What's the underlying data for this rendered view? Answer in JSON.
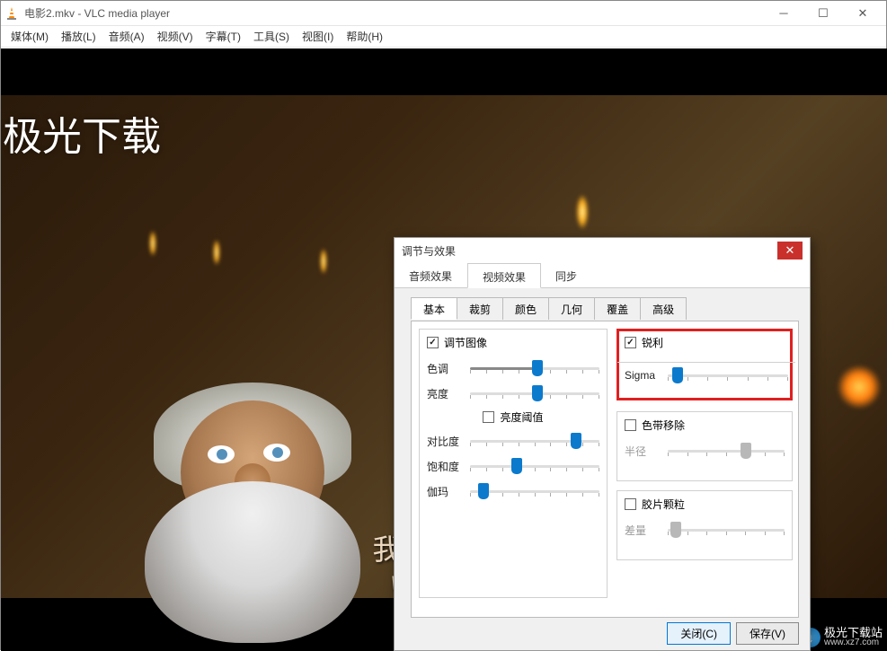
{
  "window": {
    "title": "电影2.mkv - VLC media player"
  },
  "menubar": {
    "items": [
      "媒体(M)",
      "播放(L)",
      "音频(A)",
      "视频(V)",
      "字幕(T)",
      "工具(S)",
      "视图(I)",
      "帮助(H)"
    ]
  },
  "video": {
    "watermark_top": "极光下载",
    "subtitle_cn": "我们回家去",
    "subtitle_en": "We'll go hon",
    "watermark_br_name": "极光下载站",
    "watermark_br_url": "www.xz7.com"
  },
  "dialog": {
    "title": "调节与效果",
    "main_tabs": {
      "audio": "音频效果",
      "video": "视频效果",
      "sync": "同步"
    },
    "sub_tabs": {
      "basic": "基本",
      "crop": "裁剪",
      "color": "颜色",
      "geo": "几何",
      "overlay": "覆盖",
      "adv": "高级"
    },
    "left_group": {
      "adjust": "调节图像",
      "hue": "色调",
      "brightness": "亮度",
      "brightness_threshold": "亮度阈值",
      "contrast": "对比度",
      "saturation": "饱和度",
      "gamma": "伽玛"
    },
    "right": {
      "sharpen": "锐利",
      "sigma": "Sigma",
      "banding": "色带移除",
      "radius": "半径",
      "grain": "胶片颗粒",
      "variance": "差量"
    },
    "buttons": {
      "close": "关闭(C)",
      "save": "保存(V)"
    }
  }
}
